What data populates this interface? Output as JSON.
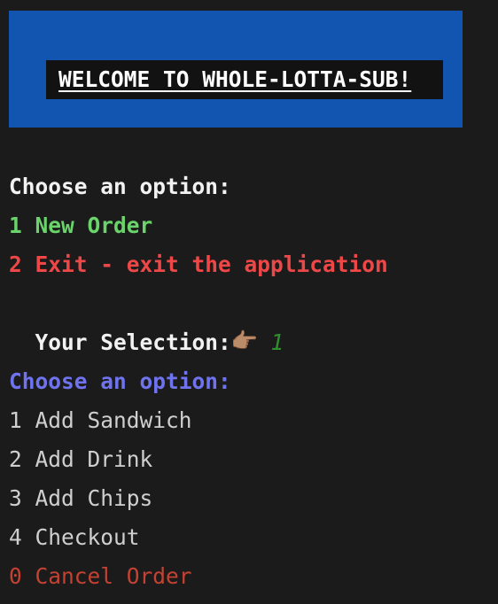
{
  "banner": {
    "title": "WELCOME TO WHOLE-LOTTA-SUB!",
    "background": "#1155b0"
  },
  "home_menu": {
    "heading": "Choose an option:",
    "options": [
      {
        "text": "1 New Order",
        "color": "#6bd36b"
      },
      {
        "text": "2 Exit - exit the application",
        "color": "#ee4747"
      }
    ],
    "prompt": "Your Selection:",
    "pointer_icon": "pointing-hand-icon",
    "pointer_glyph": "👉🏽",
    "input_value": "1"
  },
  "order_menu": {
    "heading": "Choose an option:",
    "options": [
      {
        "text": "1 Add Sandwich"
      },
      {
        "text": "2 Add Drink"
      },
      {
        "text": "3 Add Chips"
      },
      {
        "text": "4 Checkout"
      },
      {
        "text": "0 Cancel Order",
        "color": "#c44232"
      }
    ]
  }
}
